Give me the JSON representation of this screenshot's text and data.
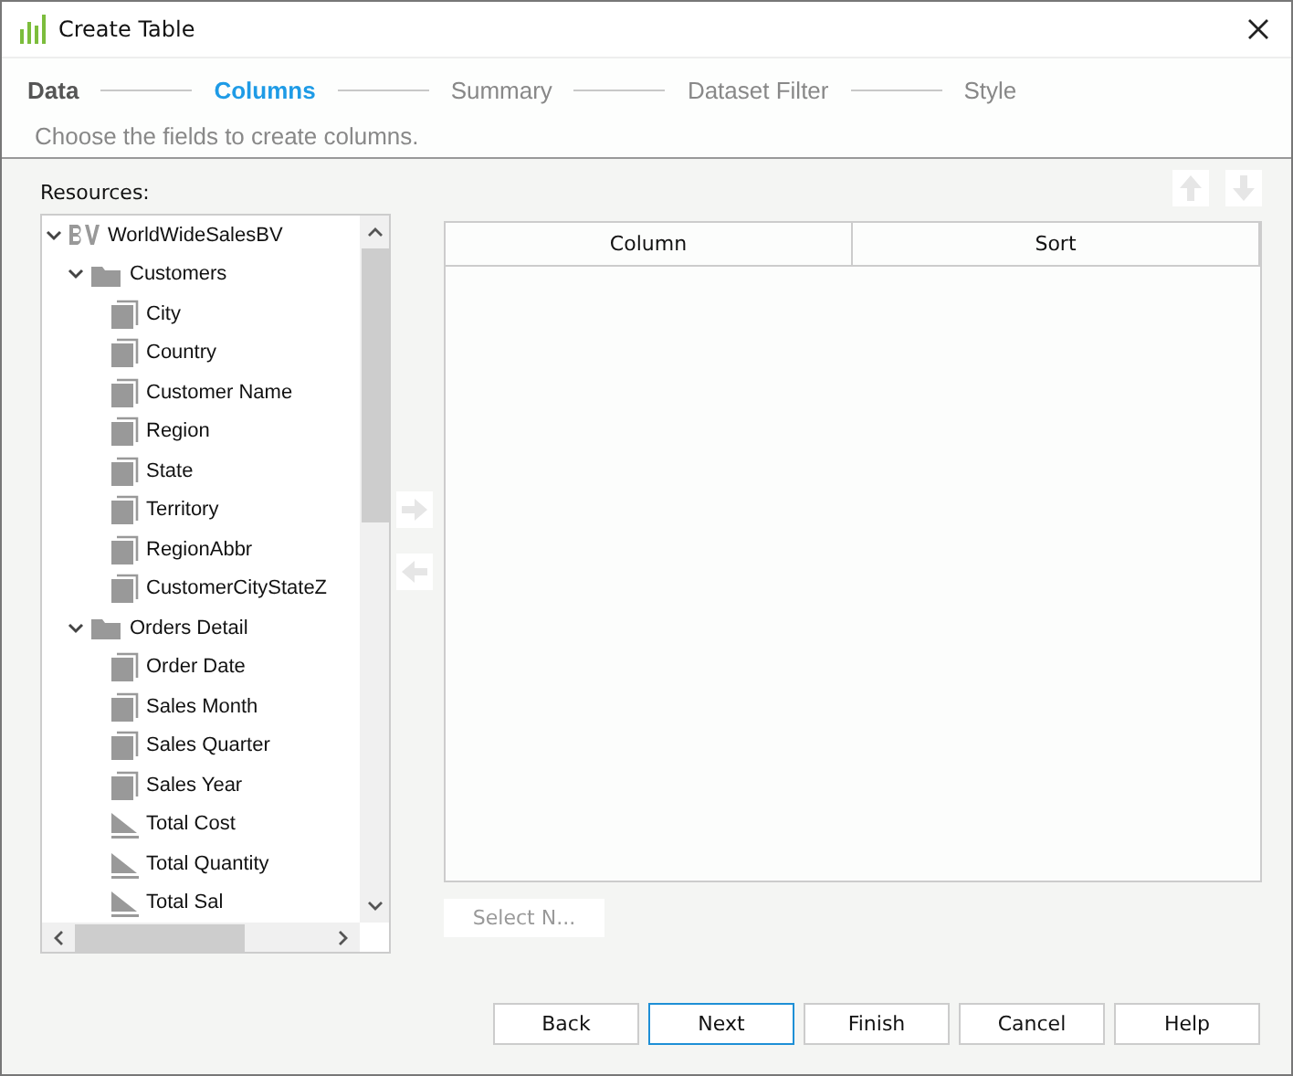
{
  "window": {
    "title": "Create Table"
  },
  "steps": [
    {
      "label": "Data",
      "selected": false,
      "completed": true
    },
    {
      "label": "Columns",
      "selected": true,
      "completed": false
    },
    {
      "label": "Summary",
      "selected": false,
      "completed": false
    },
    {
      "label": "Dataset Filter",
      "selected": false,
      "completed": false
    },
    {
      "label": "Style",
      "selected": false,
      "completed": false
    }
  ],
  "description": "Choose the fields to create columns.",
  "resources": {
    "label": "Resources:",
    "tree": [
      {
        "kind": "catalog",
        "label": "WorldWideSalesBV",
        "expanded": true,
        "children": [
          {
            "kind": "folder",
            "label": "Customers",
            "expanded": true,
            "children": [
              {
                "kind": "dimension",
                "label": "City"
              },
              {
                "kind": "dimension",
                "label": "Country"
              },
              {
                "kind": "dimension",
                "label": "Customer Name"
              },
              {
                "kind": "dimension",
                "label": "Region"
              },
              {
                "kind": "dimension",
                "label": "State"
              },
              {
                "kind": "dimension",
                "label": "Territory"
              },
              {
                "kind": "dimension",
                "label": "RegionAbbr"
              },
              {
                "kind": "dimension",
                "label": "CustomerCityStateZ"
              }
            ]
          },
          {
            "kind": "folder",
            "label": "Orders Detail",
            "expanded": true,
            "children": [
              {
                "kind": "dimension",
                "label": "Order Date"
              },
              {
                "kind": "dimension",
                "label": "Sales Month"
              },
              {
                "kind": "dimension",
                "label": "Sales Quarter"
              },
              {
                "kind": "dimension",
                "label": "Sales Year"
              },
              {
                "kind": "measure",
                "label": "Total Cost"
              },
              {
                "kind": "measure",
                "label": "Total Quantity"
              },
              {
                "kind": "measure",
                "label": "Total Sal"
              }
            ]
          }
        ]
      }
    ]
  },
  "table": {
    "columns": [
      "Column",
      "Sort"
    ]
  },
  "select_button": {
    "label": "Select N...",
    "disabled": true
  },
  "buttons": [
    {
      "label": "Back",
      "default": false
    },
    {
      "label": "Next",
      "default": true
    },
    {
      "label": "Finish",
      "default": false
    },
    {
      "label": "Cancel",
      "default": false
    },
    {
      "label": "Help",
      "default": false
    }
  ]
}
